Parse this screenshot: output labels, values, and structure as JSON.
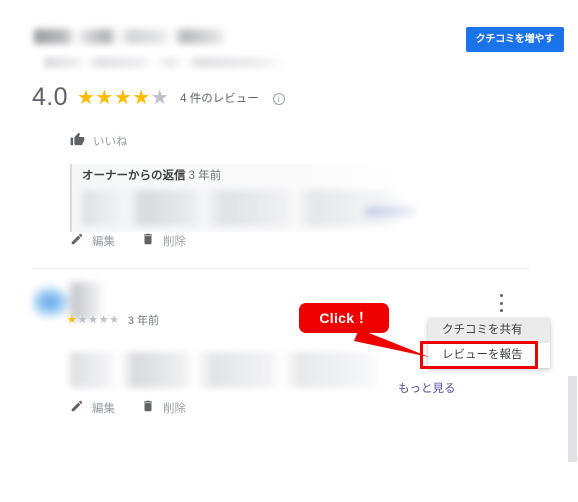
{
  "header": {
    "promote_button_label": "クチコミを増やす",
    "business_name_redacted": "",
    "business_address_redacted": ""
  },
  "rating_summary": {
    "score": "4.0",
    "stars_filled": 4,
    "stars_total": 5,
    "review_count_label": "4 件のレビュー",
    "info_icon_glyph": "i",
    "star_on_color": "#fbbc04",
    "star_off_color": "#bdc1c6"
  },
  "reviews": [
    {
      "like_label": "いいね",
      "like_icon": "thumbs-up-icon",
      "owner_reply_title": "オーナーからの返信",
      "owner_reply_ago": "3 年前",
      "owner_reply_body_redacted": "",
      "actions": [
        {
          "icon": "pencil-icon",
          "label": "編集"
        },
        {
          "icon": "trash-icon",
          "label": "削除"
        }
      ]
    },
    {
      "reviewer_name_redacted": "",
      "stars_filled": 1,
      "stars_total": 5,
      "ago": "3 年前",
      "body_redacted": "",
      "more_link_label": "もっと見る",
      "kebab_icon": "more-vertical-icon",
      "actions": [
        {
          "icon": "pencil-icon",
          "label": "編集"
        },
        {
          "icon": "trash-icon",
          "label": "削除"
        }
      ]
    }
  ],
  "dropdown_menu": {
    "items": [
      {
        "label": "クチコミを共有",
        "highlighted": false
      },
      {
        "label": "レビューを報告",
        "highlighted": true
      }
    ]
  },
  "annotation": {
    "callout_label": "Click！",
    "callout_color": "#ee0000",
    "highlight_color": "#ee0000"
  }
}
